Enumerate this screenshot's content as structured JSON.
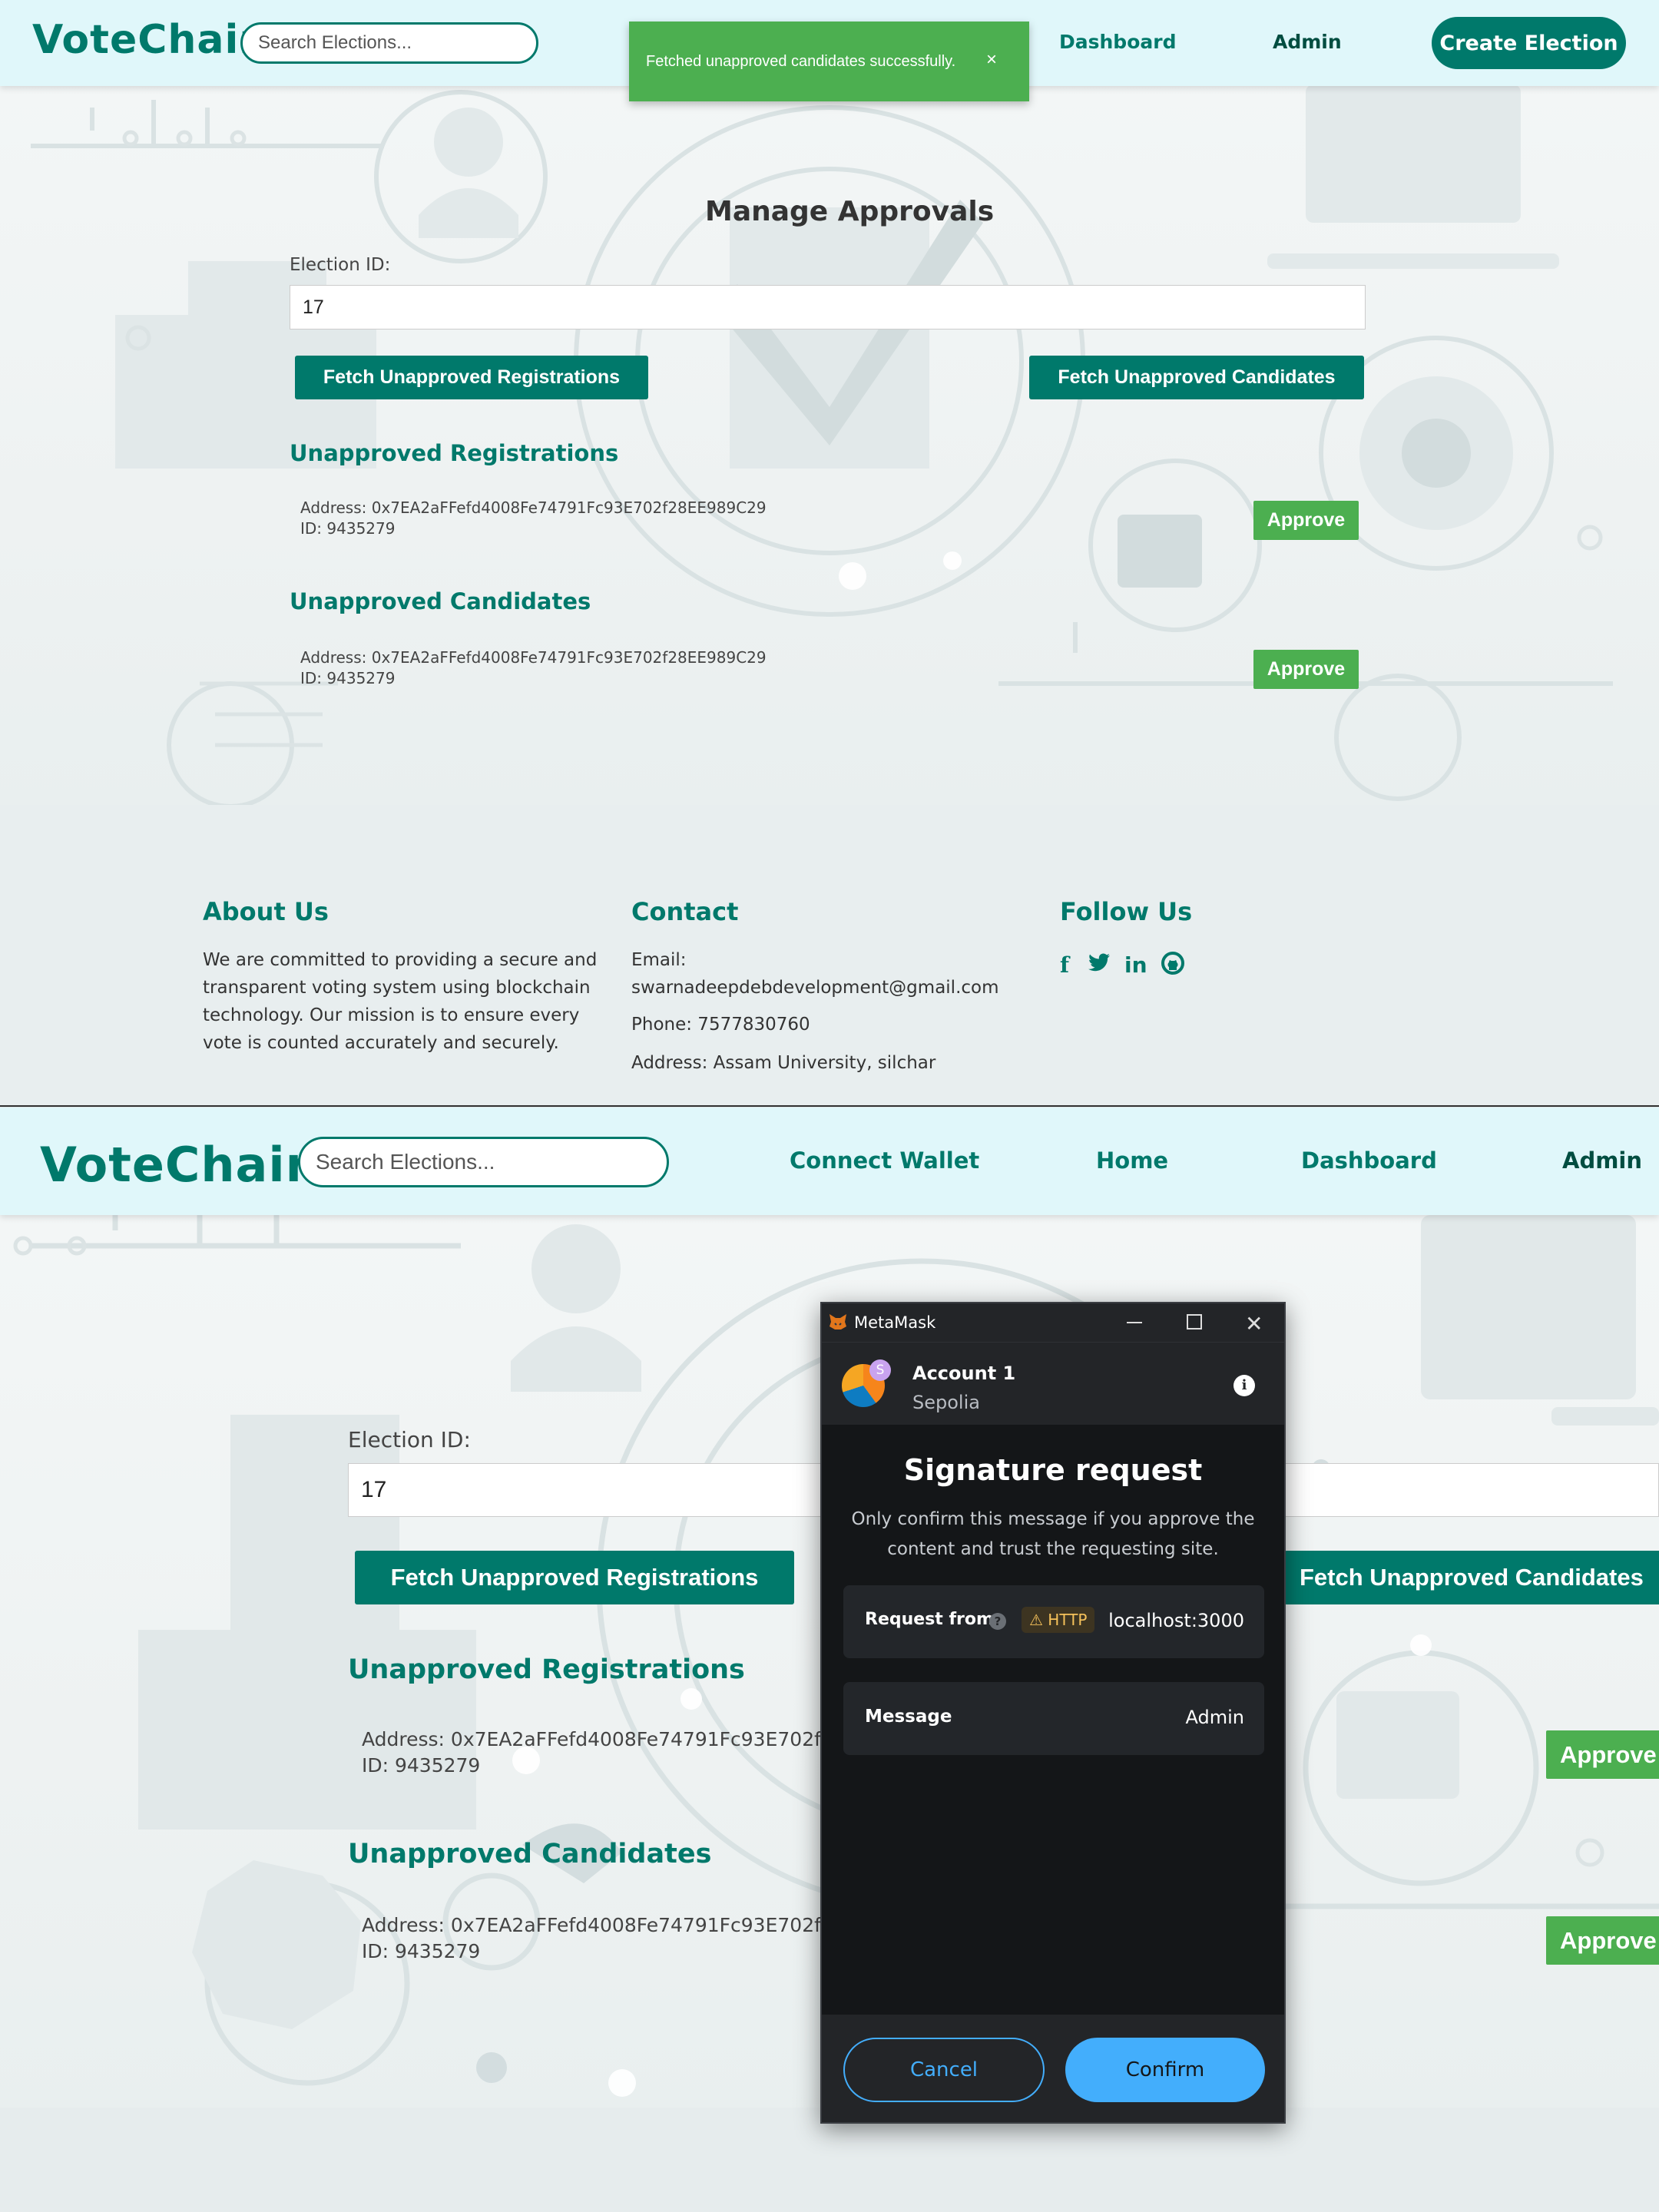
{
  "top": {
    "nav": {
      "logo": "VoteChain",
      "search_placeholder": "Search Elections...",
      "links": [
        "Dashboard",
        "Admin"
      ],
      "create_button": "Create Election"
    },
    "toast": {
      "message": "Fetched unapproved candidates successfully.",
      "close": "×"
    },
    "page_title": "Manage Approvals",
    "election_label": "Election ID:",
    "election_value": "17",
    "fetch_registrations": "Fetch Unapproved Registrations",
    "fetch_candidates": "Fetch Unapproved Candidates",
    "registrations_heading": "Unapproved Registrations",
    "candidates_heading": "Unapproved Candidates",
    "registration": {
      "address": "Address: 0x7EA2aFFefd4008Fe74791Fc93E702f28EE989C29",
      "id": "ID: 9435279",
      "approve": "Approve"
    },
    "candidate": {
      "address": "Address: 0x7EA2aFFefd4008Fe74791Fc93E702f28EE989C29",
      "id": "ID: 9435279",
      "approve": "Approve"
    }
  },
  "footer": {
    "about_title": "About Us",
    "about_lines": [
      "We are committed to providing a secure and",
      "transparent voting system using blockchain",
      "technology. Our mission is to ensure every",
      "vote is counted accurately and securely."
    ],
    "contact_title": "Contact",
    "email_label": "Email:",
    "email": "swarnadeepdebdevelopment@gmail.com",
    "phone": "Phone: 7577830760",
    "address": "Address: Assam University, silchar",
    "follow_title": "Follow Us",
    "social": [
      "f",
      "t",
      "in",
      "gh"
    ]
  },
  "bottom": {
    "nav": {
      "logo": "VoteChain",
      "search_placeholder": "Search Elections...",
      "links": [
        "Connect Wallet",
        "Home",
        "Dashboard",
        "Admin"
      ]
    },
    "election_label": "Election ID:",
    "election_value": "17",
    "fetch_registrations": "Fetch Unapproved Registrations",
    "fetch_candidates": "Fetch Unapproved Candidates",
    "registrations_heading": "Unapproved Registrations",
    "candidates_heading": "Unapproved Candidates",
    "registration": {
      "address": "Address: 0x7EA2aFFefd4008Fe74791Fc93E702f28E",
      "id": "ID: 9435279",
      "approve": "Approve"
    },
    "candidate": {
      "address": "Address: 0x7EA2aFFefd4008Fe74791Fc93E702f28E",
      "id": "ID: 9435279",
      "approve": "Approve"
    }
  },
  "metamask": {
    "window_title": "MetaMask",
    "account_name": "Account 1",
    "network": "Sepolia",
    "network_badge": "S",
    "title": "Signature request",
    "subtitle_1": "Only confirm this message if you approve the",
    "subtitle_2": "content and trust the requesting site.",
    "request_from_label": "Request from",
    "http_badge": "HTTP",
    "request_from_value": "localhost:3000",
    "message_label": "Message",
    "message_value": "Admin",
    "cancel": "Cancel",
    "confirm": "Confirm",
    "colors": {
      "accent": "#43aefc",
      "bg": "#141618",
      "panel": "#232528"
    }
  },
  "colors": {
    "teal": "#00796b",
    "green": "#4caf50",
    "nav_bg": "#e0f7fa"
  }
}
